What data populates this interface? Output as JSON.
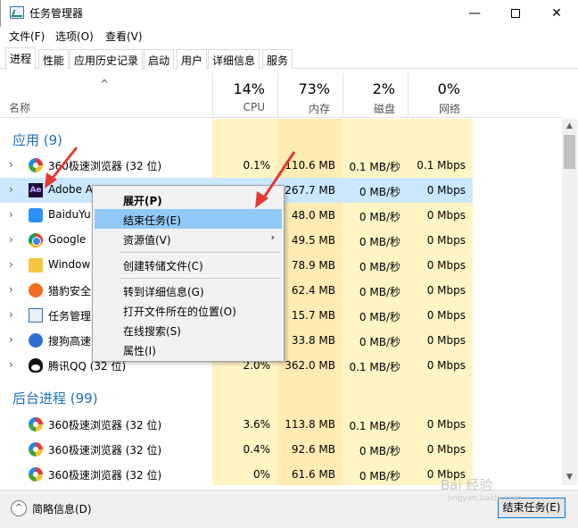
{
  "window": {
    "title": "任务管理器",
    "controls": {
      "minimize": "—",
      "close": "✕"
    }
  },
  "menu": [
    "文件(F)",
    "选项(O)",
    "查看(V)"
  ],
  "tabs": [
    {
      "label": "进程",
      "active": true
    },
    {
      "label": "性能"
    },
    {
      "label": "应用历史记录"
    },
    {
      "label": "启动"
    },
    {
      "label": "用户"
    },
    {
      "label": "详细信息"
    },
    {
      "label": "服务"
    }
  ],
  "columns": {
    "sort_arrow": "^",
    "name": "名称",
    "cpu": {
      "pct": "14%",
      "label": "CPU"
    },
    "memory": {
      "pct": "73%",
      "label": "内存"
    },
    "disk": {
      "pct": "2%",
      "label": "磁盘"
    },
    "network": {
      "pct": "0%",
      "label": "网络"
    }
  },
  "groups": {
    "apps": "应用 (9)",
    "background": "后台进程 (99)"
  },
  "app_rows": [
    {
      "name": "360极速浏览器 (32 位)",
      "cpu": "0.1%",
      "mem": "110.6 MB",
      "disk": "0.1 MB/秒",
      "net": "0.1 Mbps",
      "icon": "360-browser-icon"
    },
    {
      "name": "Adobe A",
      "cpu": "",
      "mem": "267.7 MB",
      "disk": "0 MB/秒",
      "net": "0 Mbps",
      "icon": "adobe-ae-icon",
      "selected": true
    },
    {
      "name": "BaiduYu",
      "cpu": "",
      "mem": "48.0 MB",
      "disk": "0 MB/秒",
      "net": "0 Mbps",
      "icon": "baiduyun-icon"
    },
    {
      "name": "Google",
      "cpu": "",
      "mem": "49.5 MB",
      "disk": "0 MB/秒",
      "net": "0 Mbps",
      "icon": "chrome-icon"
    },
    {
      "name": "Window",
      "cpu": "",
      "mem": "78.9 MB",
      "disk": "0 MB/秒",
      "net": "0 Mbps",
      "icon": "folder-icon"
    },
    {
      "name": "猎豹安全",
      "cpu": "",
      "mem": "62.4 MB",
      "disk": "0 MB/秒",
      "net": "0 Mbps",
      "icon": "cheetah-icon"
    },
    {
      "name": "任务管理",
      "cpu": "",
      "mem": "15.7 MB",
      "disk": "0 MB/秒",
      "net": "0 Mbps",
      "icon": "taskmgr-icon"
    },
    {
      "name": "搜狗高速",
      "cpu": "",
      "mem": "33.8 MB",
      "disk": "0 MB/秒",
      "net": "0 Mbps",
      "icon": "sogou-icon"
    },
    {
      "name": "腾讯QQ (32 位)",
      "cpu": "2.0%",
      "mem": "362.0 MB",
      "disk": "0.1 MB/秒",
      "net": "0 Mbps",
      "icon": "qq-icon"
    }
  ],
  "bg_rows": [
    {
      "name": "360极速浏览器 (32 位)",
      "cpu": "3.6%",
      "mem": "113.8 MB",
      "disk": "0.1 MB/秒",
      "net": "0 Mbps",
      "icon": "360-browser-icon"
    },
    {
      "name": "360极速浏览器 (32 位)",
      "cpu": "0.4%",
      "mem": "92.6 MB",
      "disk": "0 MB/秒",
      "net": "0 Mbps",
      "icon": "360-browser-icon"
    },
    {
      "name": "360极速浏览器 (32 位)",
      "cpu": "0%",
      "mem": "61.6 MB",
      "disk": "0 MB/秒",
      "net": "0 Mbps",
      "icon": "360-browser-icon"
    }
  ],
  "context_menu": {
    "expand": "展开(P)",
    "end_task": "结束任务(E)",
    "resource_values": "资源值(V)",
    "create_dump": "创建转储文件(C)",
    "go_to_details": "转到详细信息(G)",
    "open_file_location": "打开文件所在的位置(O)",
    "search_online": "在线搜索(S)",
    "properties": "属性(I)",
    "submenu_arrow": "›"
  },
  "footer": {
    "fewer_details": "简略信息(D)",
    "end_task_button": "结束任务(E)"
  },
  "watermark": {
    "main": "Bai 经验",
    "sub": "jingyan.baidu.com"
  },
  "colors": {
    "accent_blue": "#1f6fbf",
    "heat_yellow": "#fff4c4",
    "selection": "#cce8ff",
    "menu_highlight": "#91c9f7",
    "annotation_red": "#e53935"
  }
}
